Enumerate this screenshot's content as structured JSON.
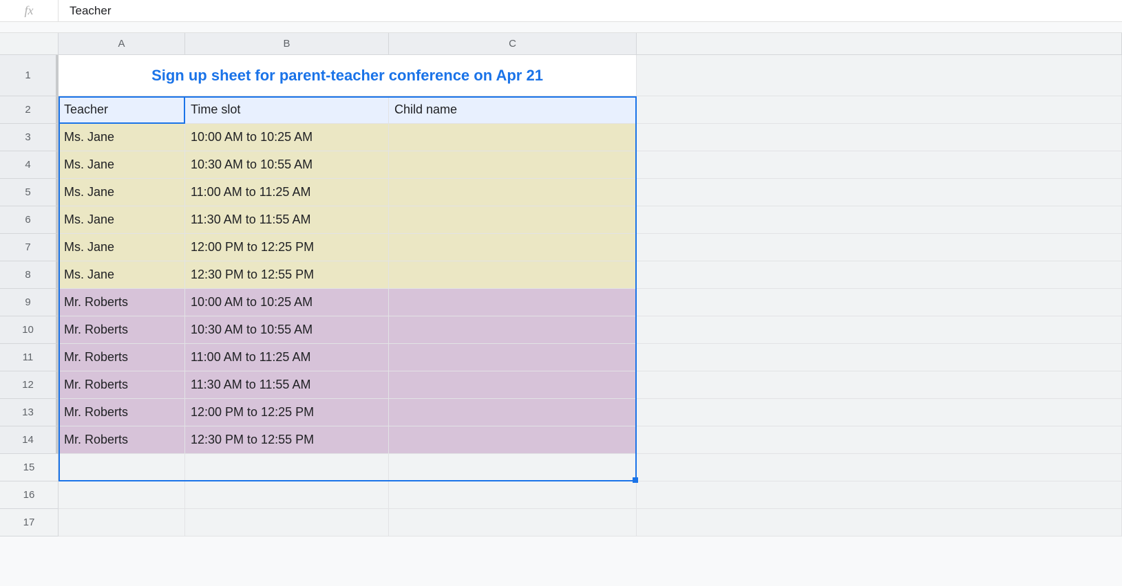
{
  "formula_bar": {
    "fx_label": "fx",
    "value": "Teacher"
  },
  "columns": [
    "A",
    "B",
    "C"
  ],
  "visible_rows": 17,
  "title": "Sign up sheet for parent-teacher conference on Apr 21",
  "headers": {
    "teacher": "Teacher",
    "time_slot": "Time slot",
    "child_name": "Child name"
  },
  "data_rows": [
    {
      "teacher": "Ms. Jane",
      "time_slot": "10:00 AM to 10:25 AM",
      "child": "",
      "group": "cream"
    },
    {
      "teacher": "Ms. Jane",
      "time_slot": "10:30 AM to 10:55 AM",
      "child": "",
      "group": "cream"
    },
    {
      "teacher": "Ms. Jane",
      "time_slot": "11:00 AM to 11:25 AM",
      "child": "",
      "group": "cream"
    },
    {
      "teacher": "Ms. Jane",
      "time_slot": "11:30 AM to 11:55 AM",
      "child": "",
      "group": "cream"
    },
    {
      "teacher": "Ms. Jane",
      "time_slot": "12:00 PM to 12:25 PM",
      "child": "",
      "group": "cream"
    },
    {
      "teacher": "Ms. Jane",
      "time_slot": "12:30 PM to 12:55 PM",
      "child": "",
      "group": "cream"
    },
    {
      "teacher": "Mr. Roberts",
      "time_slot": "10:00 AM to 10:25 AM",
      "child": "",
      "group": "purple"
    },
    {
      "teacher": "Mr. Roberts",
      "time_slot": "10:30 AM to 10:55 AM",
      "child": "",
      "group": "purple"
    },
    {
      "teacher": "Mr. Roberts",
      "time_slot": "11:00 AM to 11:25 AM",
      "child": "",
      "group": "purple"
    },
    {
      "teacher": "Mr. Roberts",
      "time_slot": "11:30 AM to 11:55 AM",
      "child": "",
      "group": "purple"
    },
    {
      "teacher": "Mr. Roberts",
      "time_slot": "12:00 PM to 12:25 PM",
      "child": "",
      "group": "purple"
    },
    {
      "teacher": "Mr. Roberts",
      "time_slot": "12:30 PM to 12:55 PM",
      "child": "",
      "group": "purple"
    }
  ],
  "colors": {
    "cream": "#ebe7c4",
    "purple": "#d7c3d9",
    "header_blue": "#e8f0fe",
    "title_blue": "#1a73e8"
  }
}
